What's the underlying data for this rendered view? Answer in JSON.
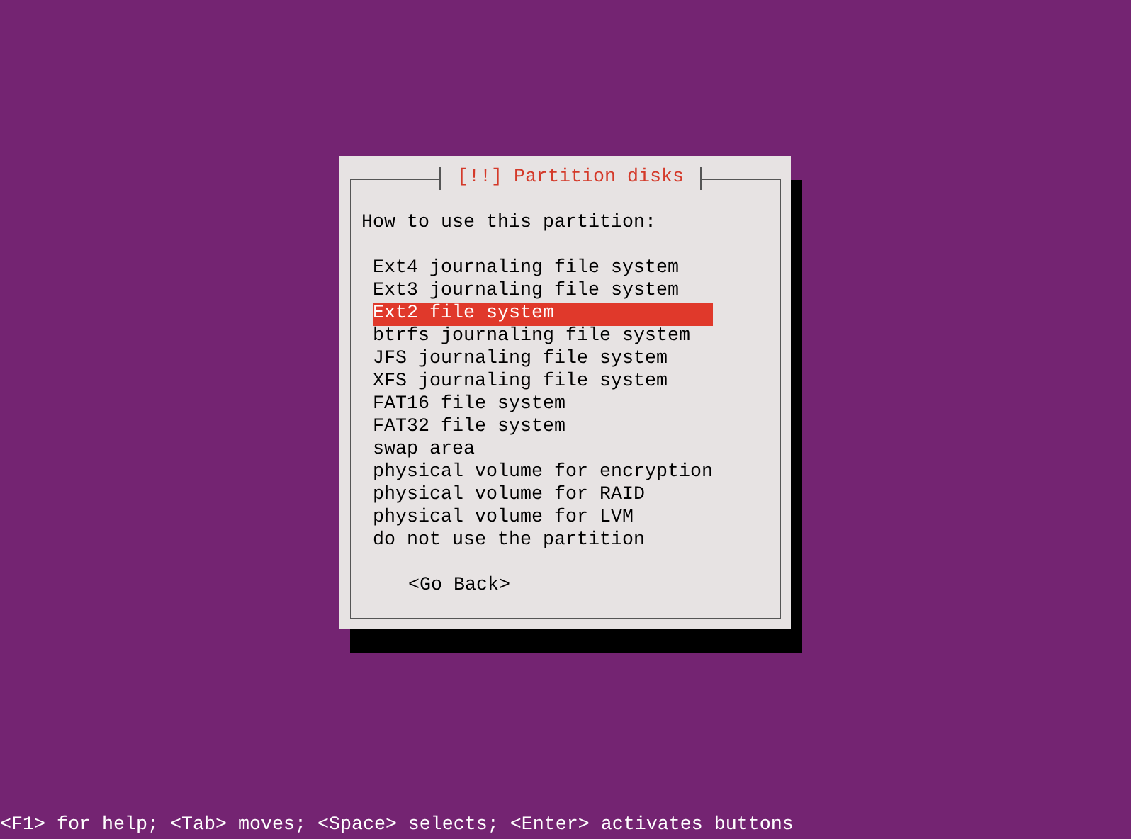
{
  "dialog": {
    "title": "[!!] Partition disks",
    "prompt": "How to use this partition:",
    "options": [
      {
        "label": "Ext4 journaling file system",
        "selected": false
      },
      {
        "label": "Ext3 journaling file system",
        "selected": false
      },
      {
        "label": "Ext2 file system",
        "selected": true
      },
      {
        "label": "btrfs journaling file system",
        "selected": false
      },
      {
        "label": "JFS journaling file system",
        "selected": false
      },
      {
        "label": "XFS journaling file system",
        "selected": false
      },
      {
        "label": "FAT16 file system",
        "selected": false
      },
      {
        "label": "FAT32 file system",
        "selected": false
      },
      {
        "label": "swap area",
        "selected": false
      },
      {
        "label": "physical volume for encryption",
        "selected": false
      },
      {
        "label": "physical volume for RAID",
        "selected": false
      },
      {
        "label": "physical volume for LVM",
        "selected": false
      },
      {
        "label": "do not use the partition",
        "selected": false
      }
    ],
    "buttons": [
      {
        "label": "<Go Back>"
      }
    ]
  },
  "status_bar": "<F1> for help; <Tab> moves; <Space> selects; <Enter> activates buttons"
}
